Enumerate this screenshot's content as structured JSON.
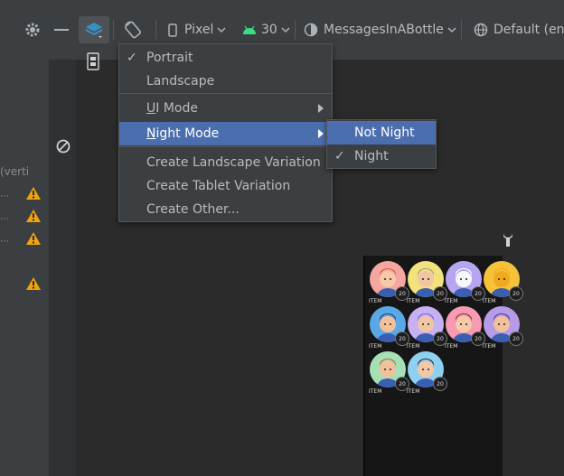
{
  "toolbar": {
    "device": "Pixel",
    "api": "30",
    "theme": "MessagesInABottle",
    "locale": "Default (en-"
  },
  "left": {
    "vertical_label": "(verti"
  },
  "menu": {
    "items": [
      {
        "label": "Portrait",
        "checked": true
      },
      {
        "label": "Landscape"
      },
      {
        "label": "UI Mode",
        "mnemonic": "U",
        "rest": "I Mode"
      },
      {
        "label": "Night Mode",
        "mnemonic": "N",
        "rest": "ight Mode"
      },
      {
        "label": "Create Landscape Variation"
      },
      {
        "label": "Create Tablet Variation"
      },
      {
        "label": "Create Other..."
      }
    ]
  },
  "submenu": {
    "items": [
      {
        "label": "Not Night"
      },
      {
        "label": "Night",
        "checked": true
      }
    ]
  },
  "preview": {
    "items": [
      {
        "label": "ITEM",
        "badge": "20",
        "bg": "#f4a7a0"
      },
      {
        "label": "ITEM",
        "badge": "20",
        "bg": "#f3e27b"
      },
      {
        "label": "ITEM",
        "badge": "20",
        "bg": "#b6a6f0"
      },
      {
        "label": "ITEM",
        "badge": "20",
        "bg": "#f6c23a"
      },
      {
        "label": "ITEM",
        "badge": "20",
        "bg": "#5aa9e6"
      },
      {
        "label": "ITEM",
        "badge": "20",
        "bg": "#c6b2f2"
      },
      {
        "label": "ITEM",
        "badge": "20",
        "bg": "#f79ab3"
      },
      {
        "label": "ITEM",
        "badge": "20",
        "bg": "#b79be8"
      },
      {
        "label": "ITEM",
        "badge": "20",
        "bg": "#a6e0b6"
      },
      {
        "label": "ITEM",
        "badge": "20",
        "bg": "#8fd0f0"
      }
    ]
  },
  "colors": {
    "accent": "#4b6eaf",
    "warning": "#f0a30a",
    "android_green": "#3ddc84"
  }
}
